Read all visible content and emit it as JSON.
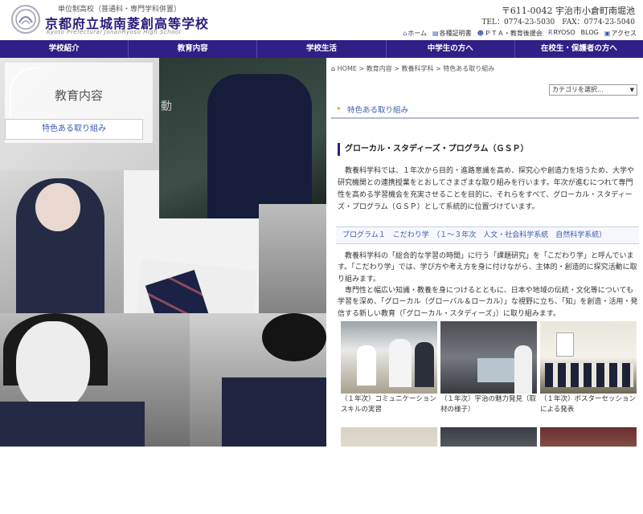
{
  "header": {
    "subtitle": "単位制高校（普通科・専門学科併置）",
    "school_name": "京都府立城南菱創高等学校",
    "school_name_en": "Kyoto Prefectural JonanRyoso High School",
    "address": "〒611-0042 宇治市小倉町南堀池",
    "phone": "TEL：0774-23-5030　FAX：0774-23-5040",
    "util_links": [
      {
        "icon": "home-icon",
        "label": "ホーム"
      },
      {
        "icon": "document-icon",
        "label": "各種証明書"
      },
      {
        "icon": "people-icon",
        "label": "ＰＴＡ・教育後援会"
      },
      {
        "icon": "r-icon",
        "label": "RYOSO"
      },
      {
        "icon": "blog-icon",
        "label": "BLOG"
      },
      {
        "icon": "access-icon",
        "label": "アクセス"
      }
    ]
  },
  "nav": {
    "items": [
      "学校紹介",
      "教育内容",
      "学校生活",
      "中学生の方へ",
      "在校生・保護者の方へ"
    ]
  },
  "sidebar": {
    "section_title": "教育内容",
    "sub_link": "特色ある取り組み",
    "chalk_text": "動"
  },
  "breadcrumb": {
    "home": "HOME",
    "sep": ">",
    "items": [
      "教育内容",
      "教養科学科",
      "特色ある取り組み"
    ]
  },
  "category_select": {
    "value": "カテゴリを選択..."
  },
  "subheader": {
    "label": "特色ある取り組み"
  },
  "article": {
    "heading": "グローカル・スタディーズ・プログラム（ＧＳＰ）",
    "intro": "教養科学科では、１年次から目的・進路意識を高め、探究心や創造力を培うため、大学や研究機関との連携授業をとおしてさまざまな取り組みを行います。年次が進むにつれて専門性を高める学習機会を充実させることを目的に、それらをすべて、グローカル・スタディーズ・プログラム（ＧＳＰ）として系統的に位置づけています。",
    "program_heading": "プログラム１　こだわり学　（１～３年次　人文・社会科学系統　自然科学系統）",
    "para1": "教養科学科の「総合的な学習の時間」に行う「課題研究」を「こだわり学」と呼んでいます。「こだわり学」では、学び方や考え方を身に付けながら、主体的・創造的に探究活動に取り組みます。",
    "para2": "専門性と幅広い知識・教養を身につけるとともに、日本や地域の伝統・文化等についても学習を深め、「グローカル（グローバル＆ローカル）」な視野に立ち、「知」を創造・活用・発信する新しい教育（「グローカル・スタディーズ」）に取り組みます。",
    "gallery": [
      {
        "caption": "（１年次）コミュニケーションスキルの実習"
      },
      {
        "caption": "（１年次）宇治の魅力発見（取材の様子）"
      },
      {
        "caption": "（１年次）ポスターセッションによる発表"
      }
    ]
  }
}
